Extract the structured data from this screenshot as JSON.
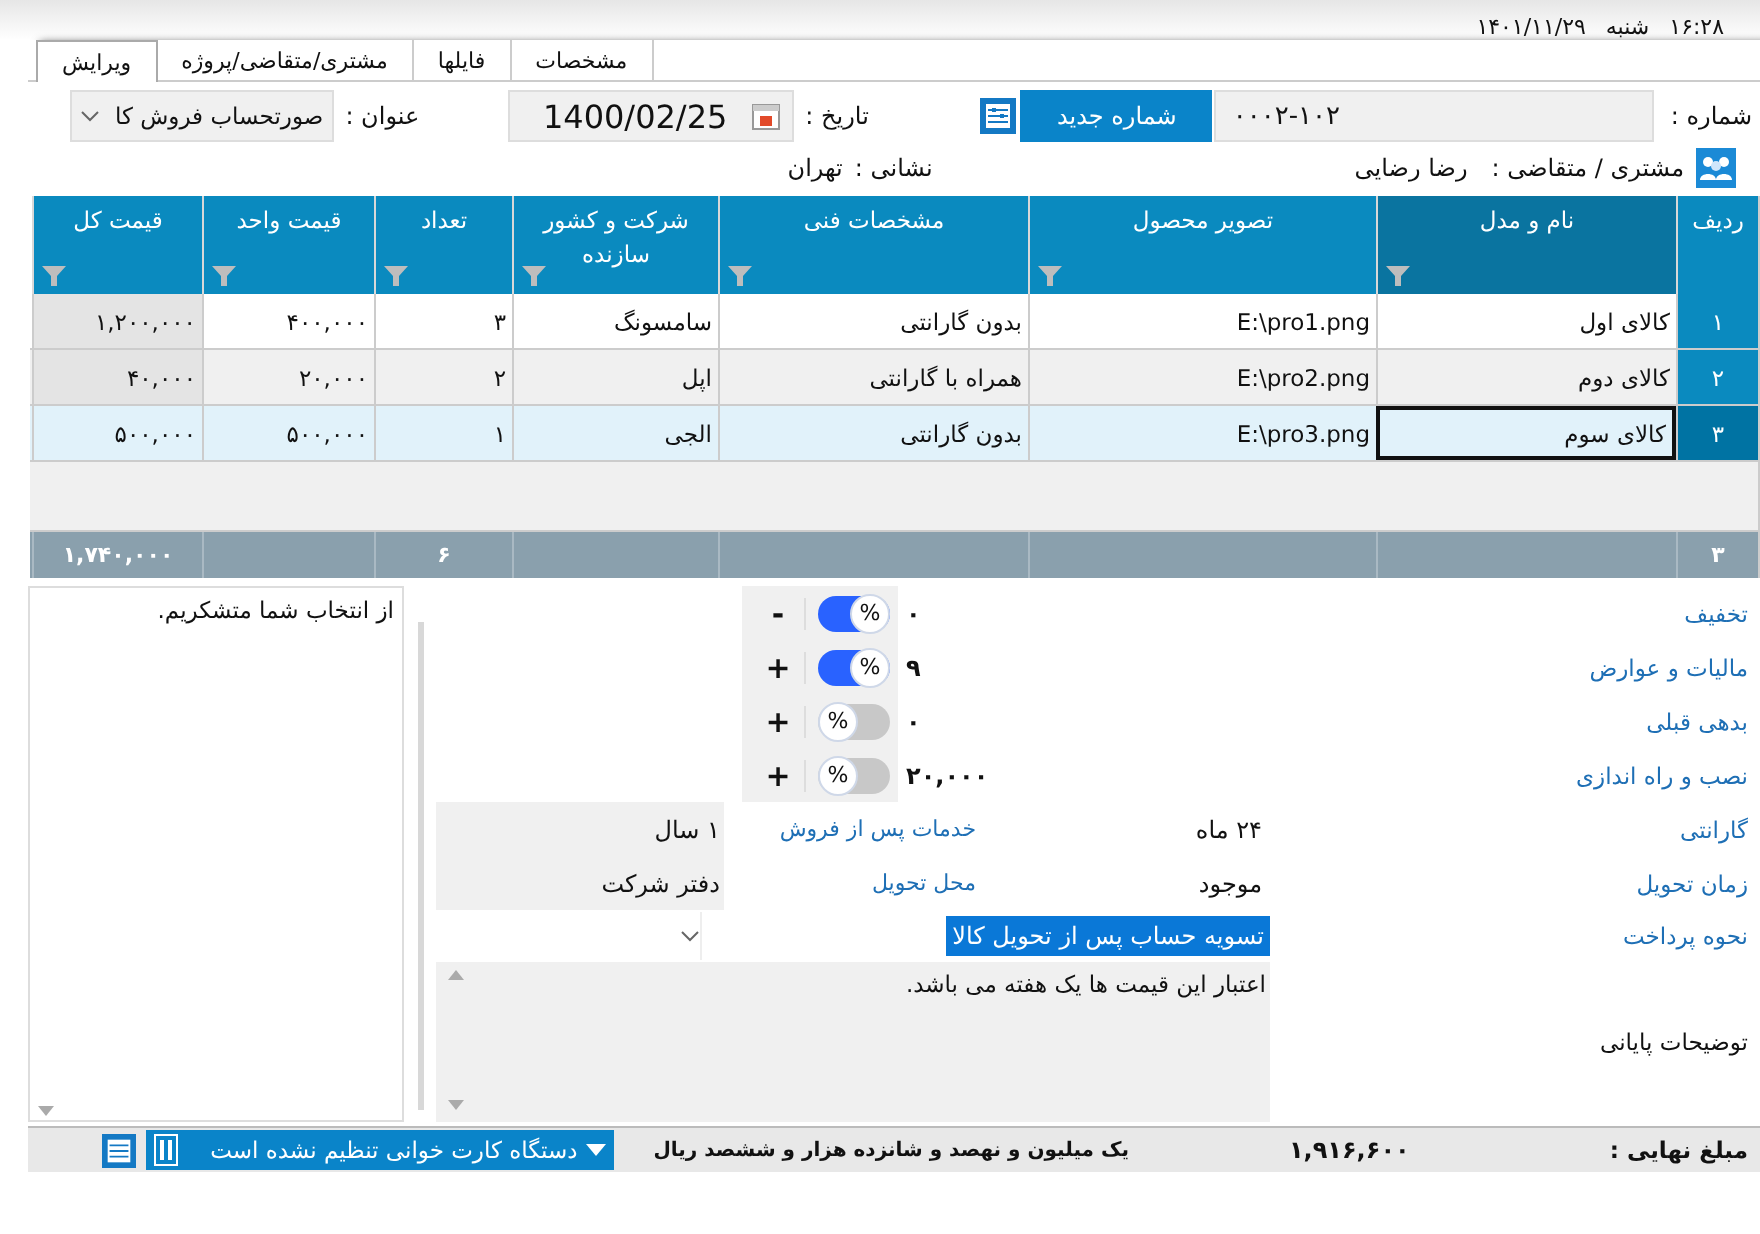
{
  "header": {
    "time": "۱۶:۲۸",
    "day": "شنبه",
    "date": "۱۴۰۱/۱۱/۲۹"
  },
  "tabs": [
    {
      "label": "مشخصات",
      "selected": false
    },
    {
      "label": "فایلها",
      "selected": false
    },
    {
      "label": "مشتری/متقاضی/پروژه",
      "selected": false
    },
    {
      "label": "ویرایش",
      "selected": true
    }
  ],
  "form": {
    "number_label": "شماره :",
    "number": "۰۰۰۲-۱۰۲",
    "new_number_button": "شماره جدید",
    "date_label": "تاریخ :",
    "date": "1400/02/25",
    "title_label": "عنوان :",
    "title": "صورتحساب فروش کا",
    "customer_label": "مشتری / متقاضی :",
    "customer": "رضا رضایی",
    "address_label": "نشانی :",
    "address": "تهران"
  },
  "table": {
    "columns": [
      {
        "label": "ردیف",
        "filter": false,
        "sorted": false
      },
      {
        "label": "نام و مدل",
        "filter": true,
        "sorted": true
      },
      {
        "label": "تصویر محصول",
        "filter": true,
        "sorted": false
      },
      {
        "label": "مشخصات فنی",
        "filter": true,
        "sorted": false
      },
      {
        "label": "شرکت و کشور سازنده",
        "filter": true,
        "sorted": false
      },
      {
        "label": "تعداد",
        "filter": true,
        "sorted": false
      },
      {
        "label": "قیمت واحد",
        "filter": true,
        "sorted": false
      },
      {
        "label": "قیمت کل",
        "filter": true,
        "sorted": false
      }
    ],
    "rows": [
      {
        "selected": false,
        "cells": [
          "۱",
          "کالای اول",
          "E:\\pro1.png",
          "بدون گارانتی",
          "سامسونگ",
          "۳",
          "۴۰۰,۰۰۰",
          "۱,۲۰۰,۰۰۰"
        ]
      },
      {
        "selected": false,
        "cells": [
          "۲",
          "کالای دوم",
          "E:\\pro2.png",
          "همراه با گارانتی",
          "اپل",
          "۲",
          "۲۰,۰۰۰",
          "۴۰,۰۰۰"
        ]
      },
      {
        "selected": true,
        "cells": [
          "۳",
          "کالای سوم",
          "E:\\pro3.png",
          "بدون گارانتی",
          "الجی",
          "۱",
          "۵۰۰,۰۰۰",
          "۵۰۰,۰۰۰"
        ]
      }
    ],
    "footer": {
      "row_count": "۳",
      "quantity": "۶",
      "total": "۱,۷۴۰,۰۰۰"
    }
  },
  "charges": [
    {
      "label": "تخفیف",
      "value": "۰",
      "toggle_label": "%",
      "on": true,
      "sign": "-"
    },
    {
      "label": "مالیات و عوارض",
      "value": "۹",
      "toggle_label": "%",
      "on": true,
      "sign": "+"
    },
    {
      "label": "بدهی قبلی",
      "value": "۰",
      "toggle_label": "%",
      "on": false,
      "sign": "+"
    },
    {
      "label": "نصب و راه اندازی",
      "value": "۲۰,۰۰۰",
      "toggle_label": "%",
      "on": false,
      "sign": "+"
    }
  ],
  "details": [
    {
      "label": "گارانتی",
      "value": "۲۴ ماه",
      "sub_label": "خدمات پس از فروش",
      "sub_value": "۱ سال"
    },
    {
      "label": "زمان تحویل",
      "value": "موجود",
      "sub_label": "محل تحویل",
      "sub_value": "دفتر شرکت"
    }
  ],
  "payment": {
    "label": "نحوه پرداخت",
    "value": "تسویه حساب پس از تحویل کالا"
  },
  "notes": {
    "label": "توضیحات پایانی",
    "text": "اعتبار این قیمت ها یک هفته می باشد."
  },
  "closing_text": "از انتخاب شما متشکریم.",
  "status_bar": {
    "total_label": "مبلغ نهایی :",
    "total": "۱,۹۱۶,۶۰۰",
    "total_words": "یک میلیون و نهصد و شانزده هزار و ششصد ریال",
    "card_reader": "دستگاه کارت خوانی تنظیم نشده است"
  }
}
